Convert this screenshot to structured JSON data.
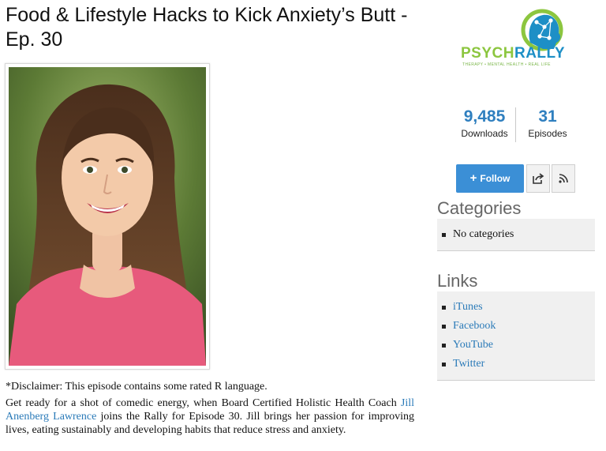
{
  "episode": {
    "title": "Food & Lifestyle Hacks to Kick Anxiety’s Butt - Ep. 30",
    "disclaimer": "*Disclaimer: This episode contains some rated R language.",
    "description_before": "Get ready for a shot of comedic energy, when Board Certified Holistic Health Coach ",
    "description_link": "Jill Anenberg Lawrence",
    "description_after": " joins the Rally for Episode 30. Jill brings her passion for improving lives, eating sustainably and developing habits that reduce stress and anxiety."
  },
  "logo": {
    "part1": "PSYCH",
    "part2": "RALLY",
    "tagline": "THERAPY • MENTAL HEALTH • REAL LIFE"
  },
  "stats": {
    "downloads_value": "9,485",
    "downloads_label": "Downloads",
    "episodes_value": "31",
    "episodes_label": "Episodes"
  },
  "actions": {
    "follow_label": "Follow",
    "share_icon": "share-icon",
    "rss_icon": "rss-icon"
  },
  "categories": {
    "title": "Categories",
    "items": [
      "No categories"
    ]
  },
  "links": {
    "title": "Links",
    "items": [
      "iTunes",
      "Facebook",
      "YouTube",
      "Twitter"
    ]
  },
  "colors": {
    "accent": "#3b8fd6",
    "link": "#2a7ab8",
    "logo_green": "#8cc63f",
    "logo_blue": "#1d8fc6"
  }
}
